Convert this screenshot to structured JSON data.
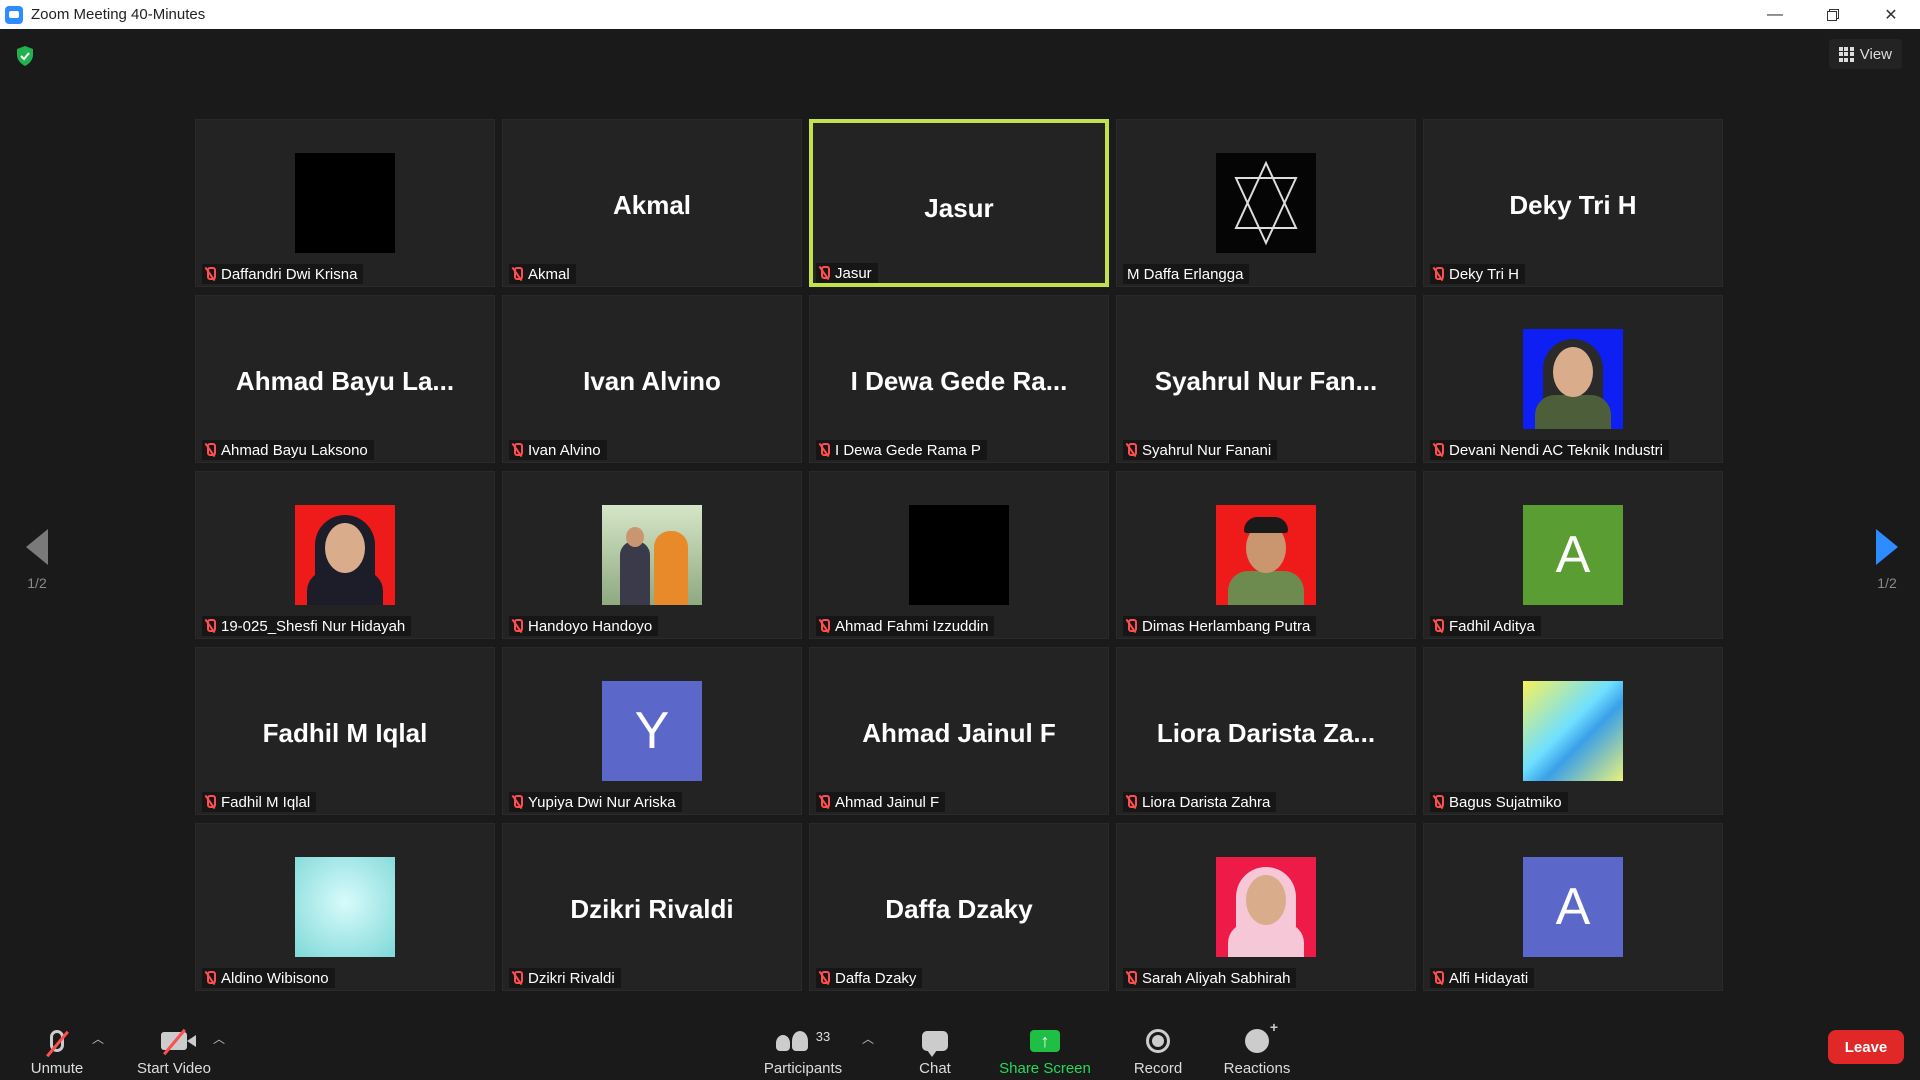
{
  "window": {
    "title": "Zoom Meeting 40-Minutes"
  },
  "meeting": {
    "view_label": "View",
    "page_left": "1/2",
    "page_right": "1/2"
  },
  "participants": [
    {
      "display": "",
      "avatar": "black",
      "label": "Daffandri Dwi Krisna",
      "muted": true
    },
    {
      "display": "Akmal",
      "avatar": "",
      "label": "Akmal",
      "muted": true
    },
    {
      "display": "Jasur",
      "avatar": "",
      "label": "Jasur",
      "muted": true,
      "active": true
    },
    {
      "display": "",
      "avatar": "star",
      "label": "M Daffa Erlangga",
      "muted": false
    },
    {
      "display": "Deky Tri H",
      "avatar": "",
      "label": "Deky Tri H",
      "muted": true
    },
    {
      "display": "Ahmad Bayu La...",
      "avatar": "",
      "label": "Ahmad Bayu Laksono",
      "muted": true
    },
    {
      "display": "Ivan Alvino",
      "avatar": "",
      "label": "Ivan Alvino",
      "muted": true
    },
    {
      "display": "I Dewa Gede Ra...",
      "avatar": "",
      "label": "I Dewa Gede Rama P",
      "muted": true
    },
    {
      "display": "Syahrul Nur Fan...",
      "avatar": "",
      "label": "Syahrul Nur Fanani",
      "muted": true
    },
    {
      "display": "",
      "avatar": "photo-blue",
      "label": "Devani Nendi AC Teknik Industri",
      "muted": true
    },
    {
      "display": "",
      "avatar": "photo-red",
      "label": "19-025_Shesfi Nur Hidayah",
      "muted": true
    },
    {
      "display": "",
      "avatar": "photo-garden",
      "label": "Handoyo Handoyo",
      "muted": true
    },
    {
      "display": "",
      "avatar": "black",
      "label": "Ahmad Fahmi Izzuddin",
      "muted": true
    },
    {
      "display": "",
      "avatar": "photo-man",
      "label": "Dimas Herlambang Putra",
      "muted": true
    },
    {
      "display": "",
      "avatar": "letter",
      "letter": "A",
      "color": "#5a9e33",
      "label": "Fadhil Aditya",
      "muted": true
    },
    {
      "display": "Fadhil M Iqlal",
      "avatar": "",
      "label": "Fadhil M Iqlal",
      "muted": true
    },
    {
      "display": "",
      "avatar": "letter",
      "letter": "Y",
      "color": "#5b67c9",
      "label": "Yupiya Dwi Nur Ariska",
      "muted": true
    },
    {
      "display": "Ahmad Jainul F",
      "avatar": "",
      "label": "Ahmad Jainul F",
      "muted": true
    },
    {
      "display": "Liora Darista Za...",
      "avatar": "",
      "label": "Liora Darista Zahra",
      "muted": true
    },
    {
      "display": "",
      "avatar": "holo",
      "label": "Bagus Sujatmiko",
      "muted": true
    },
    {
      "display": "",
      "avatar": "cyan",
      "label": "Aldino Wibisono",
      "muted": true
    },
    {
      "display": "Dzikri Rivaldi",
      "avatar": "",
      "label": "Dzikri Rivaldi",
      "muted": true
    },
    {
      "display": "Daffa Dzaky",
      "avatar": "",
      "label": "Daffa Dzaky",
      "muted": true
    },
    {
      "display": "",
      "avatar": "photo-pink",
      "label": "Sarah Aliyah Sabhirah",
      "muted": true
    },
    {
      "display": "",
      "avatar": "letter",
      "letter": "A",
      "color": "#5b67c9",
      "label": "Alfi Hidayati",
      "muted": true
    }
  ],
  "toolbar": {
    "unmute": "Unmute",
    "start_video": "Start Video",
    "participants": "Participants",
    "participants_count": "33",
    "chat": "Chat",
    "share_screen": "Share Screen",
    "record": "Record",
    "reactions": "Reactions",
    "leave": "Leave"
  },
  "colors": {
    "accent": "#2d8cff",
    "active_speaker": "#c3e14c",
    "share_green": "#1fbf45",
    "share_text": "#23d959",
    "leave_red": "#e02828",
    "muted_red": "#ff4e4e"
  }
}
